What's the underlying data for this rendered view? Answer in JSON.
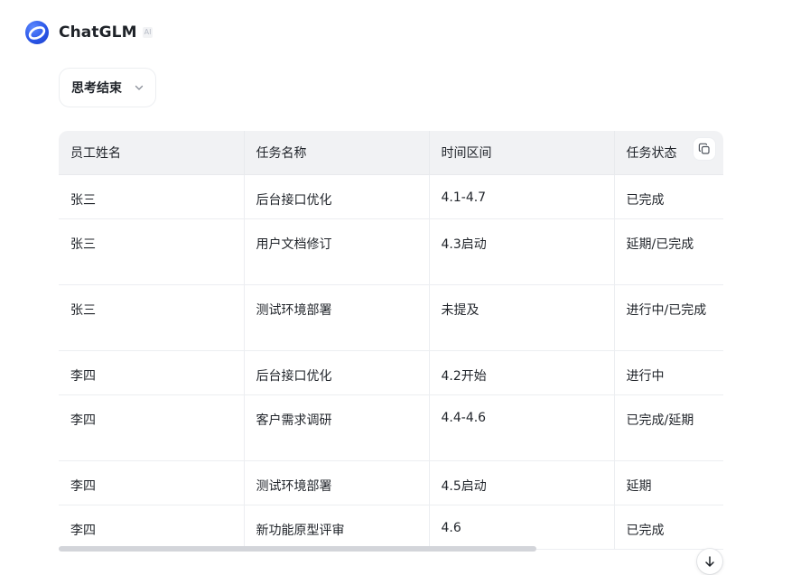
{
  "header": {
    "brand_name": "ChatGLM",
    "brand_badge": "AI"
  },
  "thinking": {
    "label": "思考结束"
  },
  "table": {
    "columns": [
      "员工姓名",
      "任务名称",
      "时间区间",
      "任务状态"
    ],
    "rows": [
      [
        "张三",
        "后台接口优化",
        "4.1-4.7",
        "已完成"
      ],
      [
        "张三",
        "用户文档修订",
        "4.3启动",
        "延期/已完成"
      ],
      [
        "张三",
        "测试环境部署",
        "未提及",
        "进行中/已完成"
      ],
      [
        "李四",
        "后台接口优化",
        "4.2开始",
        "进行中"
      ],
      [
        "李四",
        "客户需求调研",
        "4.4-4.6",
        "已完成/延期"
      ],
      [
        "李四",
        "测试环境部署",
        "4.5启动",
        "延期"
      ],
      [
        "李四",
        "新功能原型评审",
        "4.6",
        "已完成"
      ]
    ]
  },
  "colors": {
    "brand_blue": "#2a56e8",
    "header_bg": "#f1f2f4",
    "border": "#eceef1",
    "scroll_thumb": "#d3d5da"
  },
  "icons": {
    "brand": "chatglm-logo-icon",
    "chevron": "chevron-down-icon",
    "copy": "copy-icon",
    "scroll": "arrow-down-icon"
  }
}
